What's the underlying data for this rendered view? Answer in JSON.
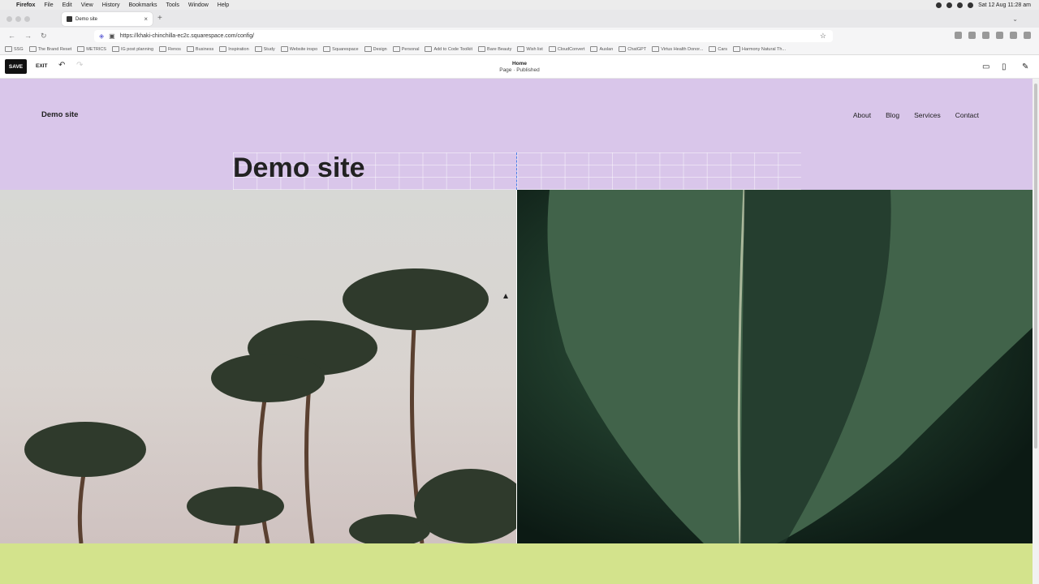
{
  "menubar": {
    "app": "Firefox",
    "items": [
      "File",
      "Edit",
      "View",
      "History",
      "Bookmarks",
      "Tools",
      "Window",
      "Help"
    ],
    "clock": "Sat 12 Aug  11:28 am"
  },
  "tab": {
    "title": "Demo site"
  },
  "url": "https://khaki-chinchilla-ec2c.squarespace.com/config/",
  "bookmarks": [
    "SSG",
    "The Brand Reset",
    "METRICS",
    "IG post planning",
    "Renos",
    "Business",
    "Inspiration",
    "Study",
    "Website inspo",
    "Squarespace",
    "Design",
    "Personal",
    "Add to Code Toolkit",
    "Bare Beauty",
    "Wish list",
    "CloudConvert",
    "Auslan",
    "ChatGPT",
    "Virtus Health Donor...",
    "Cars",
    "Harmony Natural Th..."
  ],
  "editor": {
    "save": "SAVE",
    "exit": "EXIT",
    "page_title": "Home",
    "page_status": "Page · Published"
  },
  "site": {
    "logo": "Demo site",
    "nav": [
      "About",
      "Blog",
      "Services",
      "Contact"
    ],
    "heading": "Demo site"
  },
  "colors": {
    "header_bg": "#d9c6ea",
    "footer_bg": "#d3e38c"
  }
}
